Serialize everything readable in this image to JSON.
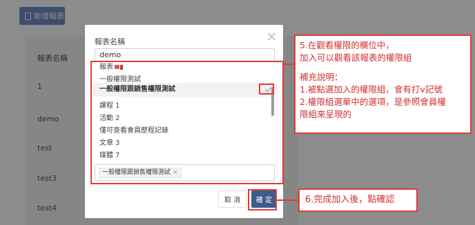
{
  "toolbar": {
    "new_report_label": "新增報表"
  },
  "bg_table": {
    "header": "報表名稱",
    "rows": [
      "1",
      "demo",
      "test",
      "test3",
      "test4"
    ]
  },
  "modal": {
    "title": "報表名稱",
    "name_value": "demo",
    "options": [
      "報表",
      "一般權限測試",
      "一般權限跟銷售權限測試",
      "課程 1",
      "活動 2",
      "僅可查看會員歷程記錄",
      "文章 3",
      "媒體 7"
    ],
    "selected_tag": "一般權限跟銷售權限測試",
    "cancel_label": "取 消",
    "ok_label": "確 定"
  },
  "annotations": {
    "note1_line1": "5.在觀看權限的欄位中，",
    "note1_line2": "加入可以觀看該報表的權限組",
    "note1_line3": "補充說明：",
    "note1_line4": "1.被點選加入的權限組，會有打v記號",
    "note1_line5": "2.權限組選單中的選項，是參照會員權",
    "note1_line6": "限組來呈現的",
    "note2": "6.完成加入後，點確認"
  },
  "colors": {
    "accent": "#3f5a8c",
    "annotation": "#e53935"
  }
}
